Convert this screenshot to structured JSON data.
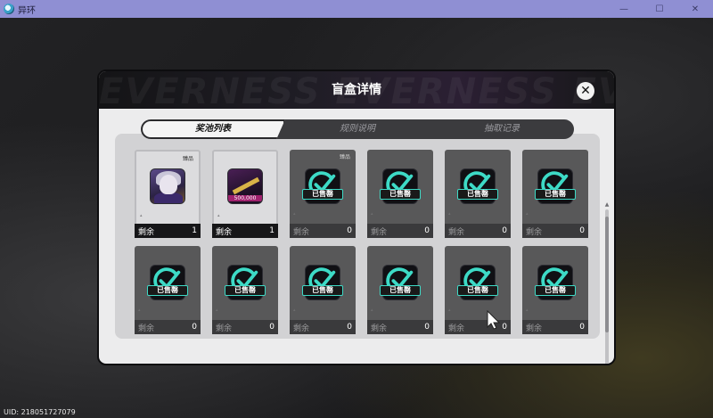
{
  "window": {
    "title": "异环",
    "controls": {
      "minimize": "—",
      "maximize": "☐",
      "close": "✕"
    }
  },
  "modal": {
    "title": "盲盒详情",
    "header_deco_text": "EVERNESS  EVERNESS  EVERNESS",
    "close_label": "✕"
  },
  "tabs": [
    {
      "label": "奖池列表",
      "active": true
    },
    {
      "label": "规则说明",
      "active": false
    },
    {
      "label": "抽取记录",
      "active": false
    }
  ],
  "cards": [
    {
      "state": "available",
      "tag": "臻品",
      "image": "character-portrait",
      "value_text": "",
      "sold_text": "",
      "remaining_label": "剩余",
      "remaining": "1"
    },
    {
      "state": "available",
      "tag": "",
      "image": "item-500000",
      "value_text": "500,000",
      "sold_text": "",
      "remaining_label": "剩余",
      "remaining": "1"
    },
    {
      "state": "sold",
      "tag": "臻品",
      "image": "sold-check",
      "value_text": "",
      "sold_text": "已售罄",
      "remaining_label": "剩余",
      "remaining": "0"
    },
    {
      "state": "sold",
      "tag": "",
      "image": "sold-check",
      "value_text": "",
      "sold_text": "已售罄",
      "remaining_label": "剩余",
      "remaining": "0"
    },
    {
      "state": "sold",
      "tag": "",
      "image": "sold-check",
      "value_text": "",
      "sold_text": "已售罄",
      "remaining_label": "剩余",
      "remaining": "0"
    },
    {
      "state": "sold",
      "tag": "",
      "image": "sold-check",
      "value_text": "",
      "sold_text": "已售罄",
      "remaining_label": "剩余",
      "remaining": "0"
    },
    {
      "state": "sold",
      "tag": "",
      "image": "sold-check",
      "value_text": "",
      "sold_text": "已售罄",
      "remaining_label": "剩余",
      "remaining": "0"
    },
    {
      "state": "sold",
      "tag": "",
      "image": "sold-check",
      "value_text": "",
      "sold_text": "已售罄",
      "remaining_label": "剩余",
      "remaining": "0"
    },
    {
      "state": "sold",
      "tag": "",
      "image": "sold-check",
      "value_text": "",
      "sold_text": "已售罄",
      "remaining_label": "剩余",
      "remaining": "0"
    },
    {
      "state": "sold",
      "tag": "",
      "image": "sold-check",
      "value_text": "",
      "sold_text": "已售罄",
      "remaining_label": "剩余",
      "remaining": "0"
    },
    {
      "state": "sold",
      "tag": "",
      "image": "sold-check",
      "value_text": "",
      "sold_text": "已售罄",
      "remaining_label": "剩余",
      "remaining": "0"
    },
    {
      "state": "sold",
      "tag": "",
      "image": "sold-check",
      "value_text": "",
      "sold_text": "已售罄",
      "remaining_label": "剩余",
      "remaining": "0"
    }
  ],
  "uid_text": "UID: 218051727079",
  "colors": {
    "accent_teal": "#3ddac6",
    "titlebar": "#8f8fd3",
    "modal_bg": "#ececed",
    "item_value_bg": "#a0226e"
  }
}
